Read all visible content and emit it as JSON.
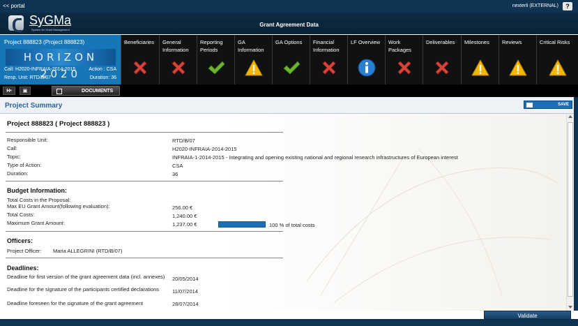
{
  "topbar": {
    "portal_link": "<< portal",
    "user": "nexterli (EXTERNAL)",
    "help": "?"
  },
  "header": {
    "logo": "SyGMa",
    "logo_sub": "System for Grant Management",
    "title": "Grant Agreement Data"
  },
  "project": {
    "name": "Project 888823 (Project 888823)",
    "programme": "HORIZON 2020",
    "call": "Call: H2020-INFRAIA-2014-2015",
    "action": "Action : CSA",
    "resp_unit": "Resp. Unit: RTD/B/07",
    "duration": "Duration: 36"
  },
  "tabs": [
    {
      "label": "Beneficiaries",
      "status": "error"
    },
    {
      "label": "General Information",
      "status": "error"
    },
    {
      "label": "Reporting Periods",
      "status": "ok"
    },
    {
      "label": "GA Information",
      "status": "warning"
    },
    {
      "label": "GA Options",
      "status": "ok"
    },
    {
      "label": "Financial Information",
      "status": "error"
    },
    {
      "label": "LF Overview",
      "status": "info"
    },
    {
      "label": "Work Packages",
      "status": "error"
    },
    {
      "label": "Deliverables",
      "status": "error"
    },
    {
      "label": "Milestones",
      "status": "warning"
    },
    {
      "label": "Reviews",
      "status": "warning"
    },
    {
      "label": "Critical Risks",
      "status": "warning"
    }
  ],
  "toolbar": {
    "btn1": "H•",
    "btn2": "▣",
    "documents": "DOCUMENTS"
  },
  "summary": {
    "title": "Project Summary",
    "save": "SAVE"
  },
  "details": {
    "heading": "Project 888823 ( Project 888823 )",
    "rows": [
      {
        "label": "Responsible Unit:",
        "value": "RTD/B/07"
      },
      {
        "label": "Call:",
        "value": "H2020-INFRAIA-2014-2015"
      },
      {
        "label": "Topic:",
        "value": "INFRAIA-1-2014-2015 - Integrating and opening existing national and regional research infrastructures of European interest"
      },
      {
        "label": "Type of Action:",
        "value": "CSA"
      },
      {
        "label": "Duration:",
        "value": "36"
      }
    ]
  },
  "budget": {
    "heading": "Budget Information:",
    "total_costs_proposal_label": "Total Costs in the Proposal:",
    "max_eu_label": "Max EU Grant Amount(following evaluation):",
    "max_eu_value": "256.00 €",
    "total_costs_label": "Total Costs:",
    "total_costs_value": "1,240.00 €",
    "max_grant_label": "Maximum Grant Amount:",
    "max_grant_value": "1,237.00 €",
    "progress_percent": 100,
    "progress_text": "100 % of total costs"
  },
  "officers": {
    "heading": "Officers:",
    "label": "Project Officer:",
    "value": "Maria ALLEGRINI (RTD/B/07)"
  },
  "deadlines": {
    "heading": "Deadlines:",
    "rows": [
      {
        "label": "Deadline for first version of the grant agreement data (incl. annexes)",
        "value": "20/05/2014"
      },
      {
        "label": "Deadline for the signature of the participants certified declarations",
        "value": "11/07/2014"
      },
      {
        "label": "Deadline foreseen for the signature of the grant agreement",
        "value": "28/07/2014"
      }
    ]
  },
  "footer": {
    "validate": "Validate"
  },
  "colors": {
    "error": "#d9443a",
    "ok": "#6cb52d",
    "warning": "#f2b705",
    "info": "#2a7fd0"
  }
}
